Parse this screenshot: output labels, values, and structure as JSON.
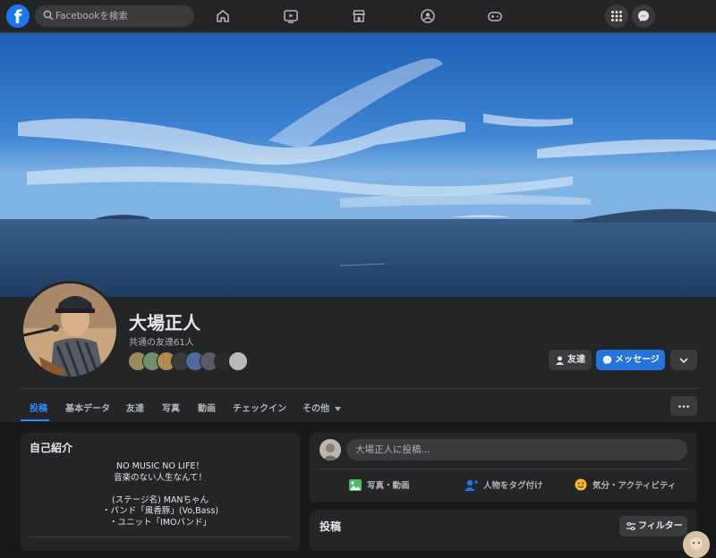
{
  "topbar": {
    "logo": "f",
    "search_placeholder": "Facebookを検索",
    "nav_icons": [
      "home-icon",
      "video-icon",
      "marketplace-icon",
      "groups-icon",
      "gaming-icon"
    ],
    "right_icons": [
      "menu-grid-icon",
      "messenger-icon"
    ]
  },
  "profile": {
    "name": "大場正人",
    "mutual_friends": "共通の友達61人",
    "mutual_avatar_count": 8,
    "buttons": {
      "friend": "友達",
      "message": "メッセージ"
    }
  },
  "tabs": [
    {
      "label": "投稿",
      "active": true
    },
    {
      "label": "基本データ",
      "active": false
    },
    {
      "label": "友達",
      "active": false
    },
    {
      "label": "写真",
      "active": false
    },
    {
      "label": "動画",
      "active": false
    },
    {
      "label": "チェックイン",
      "active": false
    },
    {
      "label": "その他",
      "active": false
    }
  ],
  "intro": {
    "title": "自己紹介",
    "bio_lines": [
      "NO MUSIC NO LIFE！",
      "音楽のない人生なんて！",
      "",
      "(ステージ名) MANちゃん",
      "・バンド「風香豚」(Vo,Bass)",
      "・ユニット「IMOバンド」"
    ]
  },
  "composer": {
    "placeholder": "大場正人に投稿...",
    "actions": [
      {
        "label": "写真・動画",
        "icon": "photo-video-icon",
        "color": "#45bd62"
      },
      {
        "label": "人物をタグ付け",
        "icon": "tag-people-icon",
        "color": "#1877f2"
      },
      {
        "label": "気分・アクティビティ",
        "icon": "feeling-icon",
        "color": "#f7b928"
      }
    ]
  },
  "posts": {
    "title": "投稿",
    "filter_label": "フィルター"
  },
  "colors": {
    "brand": "#1877f2",
    "active_tab": "#2d88ff",
    "background": "#18191a",
    "surface": "#242526"
  }
}
